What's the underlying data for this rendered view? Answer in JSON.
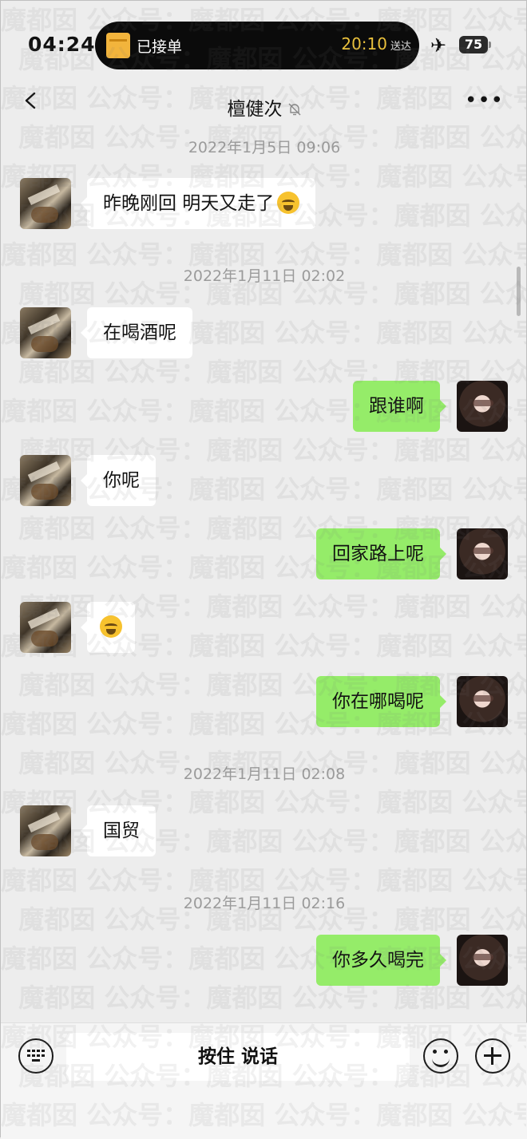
{
  "status_bar": {
    "time": "04:24",
    "island_label": "已接单",
    "island_time": "20:10",
    "island_sub": "送达",
    "battery": "75",
    "icons": [
      "package-icon",
      "airplane-icon",
      "battery-icon"
    ]
  },
  "nav": {
    "title": "檀健次",
    "icons": [
      "back-icon",
      "mute-bell-icon",
      "more-icon"
    ]
  },
  "timestamps": [
    "2022年1月5日 09:06",
    "2022年1月11日 02:02",
    "2022年1月11日 02:08",
    "2022年1月11日 02:16"
  ],
  "messages": [
    {
      "from": "other",
      "text": "昨晚刚回 明天又走了",
      "emoji": "crying-face-emoji"
    },
    {
      "from": "other",
      "text": "在喝酒呢"
    },
    {
      "from": "me",
      "text": "跟谁啊"
    },
    {
      "from": "other",
      "text": "你呢"
    },
    {
      "from": "me",
      "text": "回家路上呢"
    },
    {
      "from": "other",
      "text": "",
      "emoji": "crying-face-emoji"
    },
    {
      "from": "me",
      "text": "你在哪喝呢"
    },
    {
      "from": "other",
      "text": "国贸"
    },
    {
      "from": "me",
      "text": "你多久喝完"
    }
  ],
  "bottom_bar": {
    "hold_to_talk": "按住 说话",
    "icons": [
      "keyboard-icon",
      "emoji-icon",
      "plus-icon"
    ]
  },
  "watermark": "魔都囡 公众号："
}
